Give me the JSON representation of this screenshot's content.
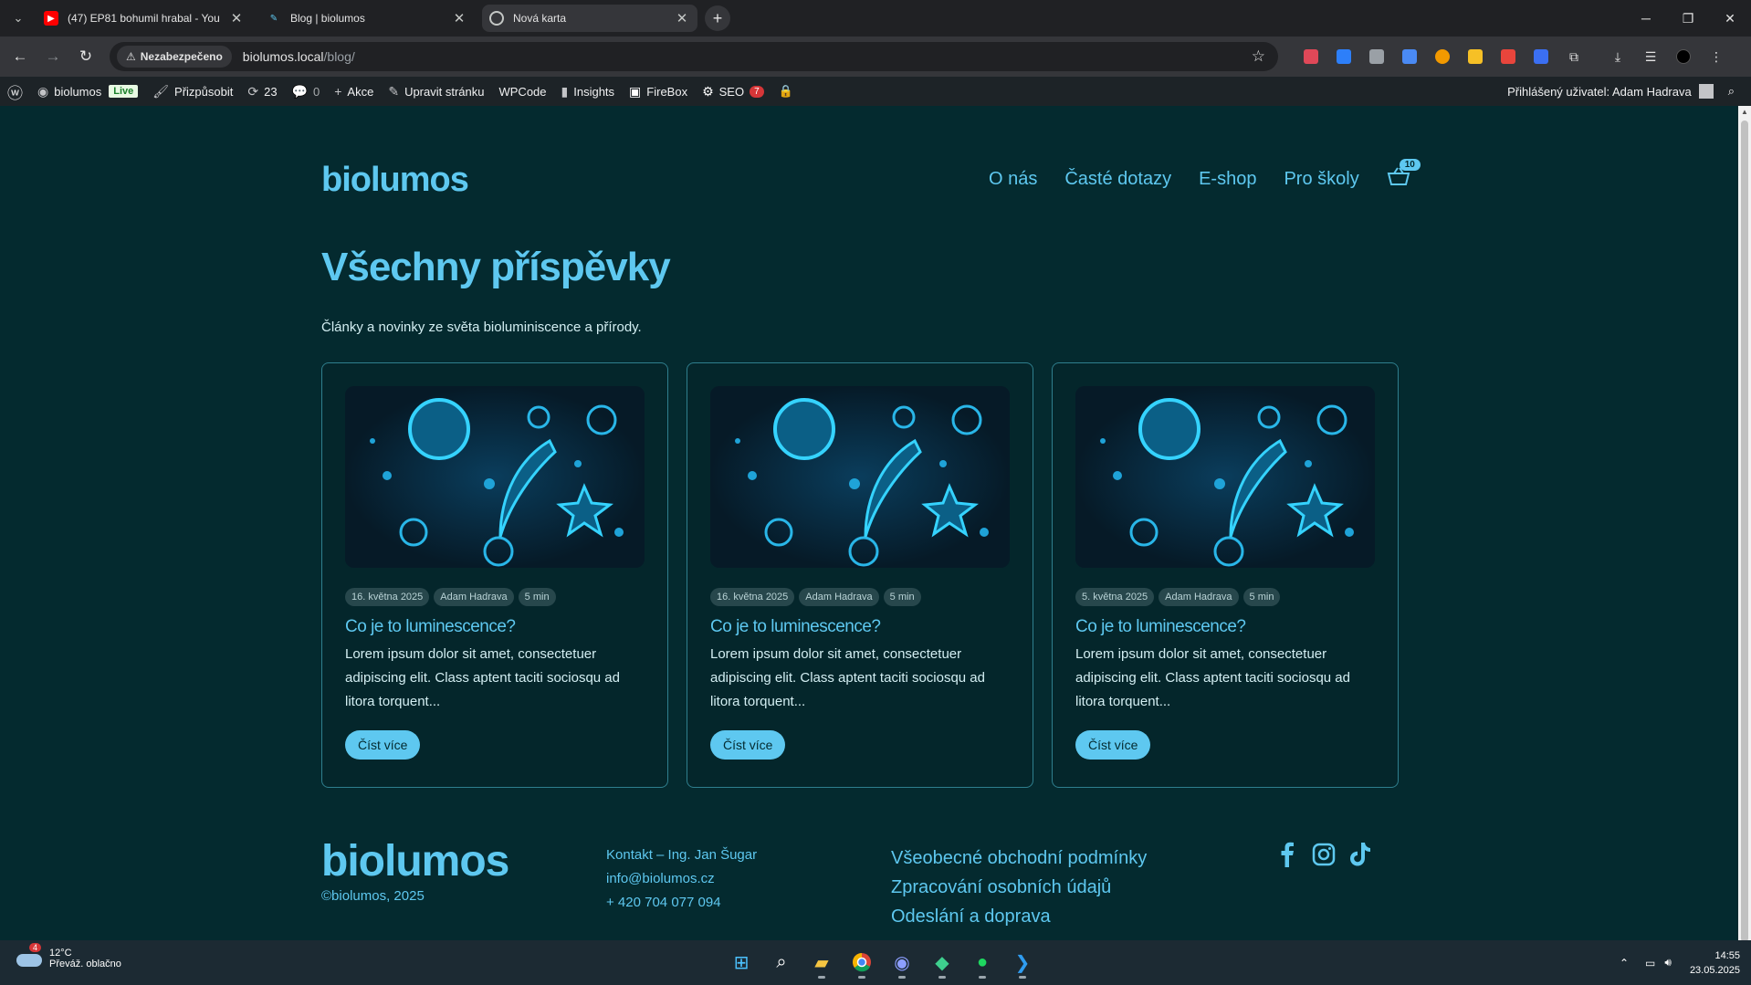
{
  "browser": {
    "tabs": [
      {
        "title": "(47) EP81 bohumil hrabal - You",
        "active": false
      },
      {
        "title": "Blog | biolumos",
        "active": true
      },
      {
        "title": "Nová karta",
        "active": false
      }
    ],
    "security_label": "Nezabezpečeno",
    "url_host": "biolumos.local",
    "url_path": "/blog/"
  },
  "adminbar": {
    "site_name": "biolumos",
    "live_badge": "Live",
    "customize": "Přizpůsobit",
    "updates_count": "23",
    "comments_count": "0",
    "new_label": "Akce",
    "edit_page": "Upravit stránku",
    "wpcode": "WPCode",
    "insights": "Insights",
    "firebox": "FireBox",
    "seo": "SEO",
    "seo_count": "7",
    "greeting": "Přihlášený uživatel: Adam Hadrava"
  },
  "site": {
    "logo": "biolumos",
    "nav": [
      "O nás",
      "Časté dotazy",
      "E-shop",
      "Pro školy"
    ],
    "cart_count": "10",
    "heading": "Všechny příspěvky",
    "lead": "Články a novinky ze světa bioluminiscence a přírody.",
    "posts": [
      {
        "date": "16. května 2025",
        "author": "Adam Hadrava",
        "read_time": "5 min",
        "title": "Co je to luminescence?",
        "excerpt": "Lorem ipsum dolor sit amet, consectetuer adipiscing elit. Class aptent taciti sociosqu ad litora torquent...",
        "button": "Číst více"
      },
      {
        "date": "16. května 2025",
        "author": "Adam Hadrava",
        "read_time": "5 min",
        "title": "Co je to luminescence?",
        "excerpt": "Lorem ipsum dolor sit amet, consectetuer adipiscing elit. Class aptent taciti sociosqu ad litora torquent...",
        "button": "Číst více"
      },
      {
        "date": "5. května 2025",
        "author": "Adam Hadrava",
        "read_time": "5 min",
        "title": "Co je to luminescence?",
        "excerpt": "Lorem ipsum dolor sit amet, consectetuer adipiscing elit. Class aptent taciti sociosqu ad litora torquent...",
        "button": "Číst více"
      }
    ],
    "footer": {
      "logo": "biolumos",
      "copyright": "©biolumos, 2025",
      "contact_name": "Kontakt – Ing. Jan Šugar",
      "email": "info@biolumos.cz",
      "phone": "+ 420 704 077 094",
      "links": [
        "Všeobecné obchodní podmínky",
        "Zpracování osobních údajů",
        "Odeslání a doprava"
      ]
    },
    "colors": {
      "background": "#042a2f",
      "accent": "#5ec8f0"
    }
  },
  "taskbar": {
    "temperature": "12°C",
    "weather": "Převáž. oblačno",
    "weather_badge": "4",
    "time": "14:55",
    "date": "23.05.2025"
  }
}
